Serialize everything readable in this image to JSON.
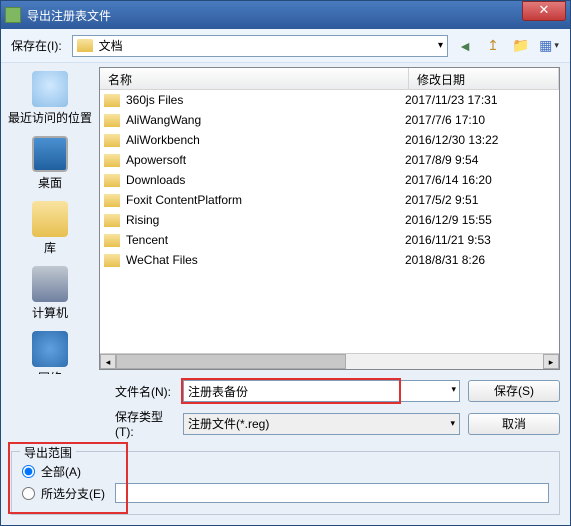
{
  "window": {
    "title": "导出注册表文件"
  },
  "toolbar": {
    "save_in_label": "保存在(I):",
    "location": "文档"
  },
  "sidebar": {
    "items": [
      {
        "label": "最近访问的位置"
      },
      {
        "label": "桌面"
      },
      {
        "label": "库"
      },
      {
        "label": "计算机"
      },
      {
        "label": "网络"
      }
    ]
  },
  "filelist": {
    "header_name": "名称",
    "header_date": "修改日期",
    "rows": [
      {
        "name": "360js Files",
        "date": "2017/11/23 17:31"
      },
      {
        "name": "AliWangWang",
        "date": "2017/7/6 17:10"
      },
      {
        "name": "AliWorkbench",
        "date": "2016/12/30 13:22"
      },
      {
        "name": "Apowersoft",
        "date": "2017/8/9 9:54"
      },
      {
        "name": "Downloads",
        "date": "2017/6/14 16:20"
      },
      {
        "name": "Foxit ContentPlatform",
        "date": "2017/5/2 9:51"
      },
      {
        "name": "Rising",
        "date": "2016/12/9 15:55"
      },
      {
        "name": "Tencent",
        "date": "2016/11/21 9:53"
      },
      {
        "name": "WeChat Files",
        "date": "2018/8/31 8:26"
      }
    ]
  },
  "inputs": {
    "filename_label": "文件名(N):",
    "filename_value": "注册表备份",
    "filetype_label": "保存类型(T):",
    "filetype_value": "注册文件(*.reg)",
    "save_btn": "保存(S)",
    "cancel_btn": "取消"
  },
  "export_range": {
    "legend": "导出范围",
    "all_label": "全部(A)",
    "branch_label": "所选分支(E)"
  }
}
